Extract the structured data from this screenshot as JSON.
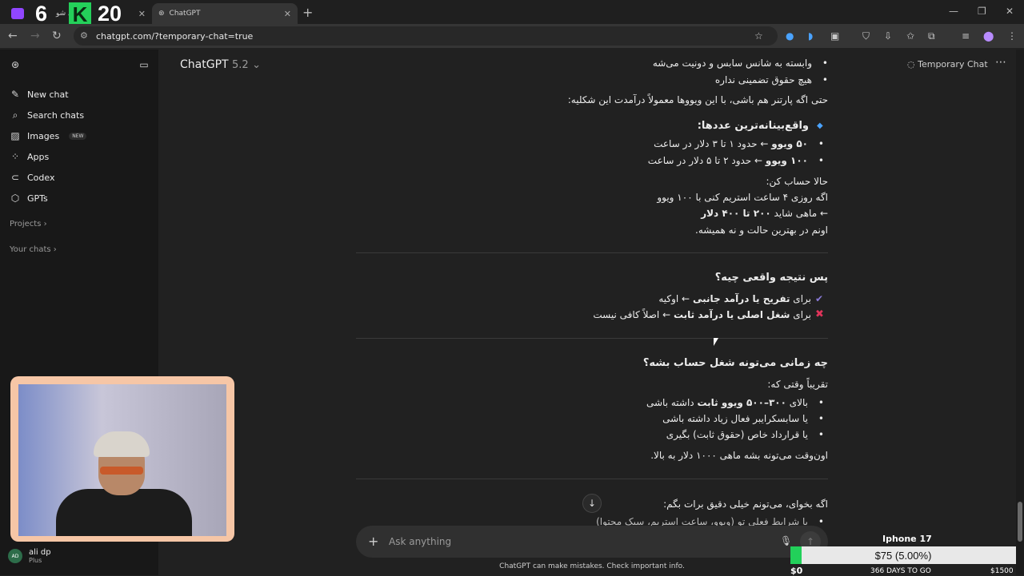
{
  "browser": {
    "tabs": [
      {
        "title": "ل شو",
        "active": false
      },
      {
        "title": "ChatGPT",
        "active": true
      }
    ],
    "url": "chatgpt.com/?temporary-chat=true",
    "overlay_numbers": [
      "6",
      "K",
      "20"
    ]
  },
  "sidebar": {
    "items": [
      {
        "icon": "pencil-square-icon",
        "label": "New chat"
      },
      {
        "icon": "search-icon",
        "label": "Search chats"
      },
      {
        "icon": "image-icon",
        "label": "Images",
        "badge": "NEW"
      },
      {
        "icon": "grid-icon",
        "label": "Apps"
      },
      {
        "icon": "code-icon",
        "label": "Codex"
      },
      {
        "icon": "gpt-icon",
        "label": "GPTs"
      }
    ],
    "sections": [
      "Projects",
      "Your chats"
    ],
    "user": {
      "initials": "AD",
      "name": "ali dp",
      "plan": "Plus"
    }
  },
  "header": {
    "model_name": "ChatGPT",
    "model_version": "5.2",
    "temporary_chat": "Temporary Chat"
  },
  "content": {
    "b_top1": "وابسته به شانس سابس و دونیت می‌شه",
    "b_top2": "هیچ حقوق تضمینی نداره",
    "para1": "حتی اگه پارتنر هم باشی، با این ویووها معمولاً درآمدت این شکلیه:",
    "h_real": "واقع‌بینانه‌ترین عددها:",
    "r1_bold": "۵۰ ویوو",
    "r1_rest": " ← حدود ۱ تا ۳ دلار در ساعت",
    "r2_bold": "۱۰۰ ویوو",
    "r2_rest": " ← حدود ۲ تا ۵ دلار در ساعت",
    "calc1": "حالا حساب کن:",
    "calc2": "اگه روزی ۴ ساعت استریم کنی با ۱۰۰ ویوو",
    "calc3_pre": "← ماهی شاید ",
    "calc3_bold": "۲۰۰ تا ۴۰۰ دلار",
    "calc4": "اونم در بهترین حالت و نه همیشه.",
    "h_result": "پس نتیجه واقعی چیه؟",
    "res1_pre": "برای ",
    "res1_bold": "تفریح یا درآمد جانبی",
    "res1_rest": " ← اوکیه",
    "res2_pre": "برای ",
    "res2_bold": "شغل اصلی یا درآمد ثابت",
    "res2_rest": " ← اصلاً کافی نیست",
    "h_when": "چه زمانی می‌تونه شغل حساب بشه؟",
    "approx": "تقریباً وقتی که:",
    "w1_pre": "بالای ",
    "w1_bold": "۳۰۰–۵۰۰ ویوو ثابت",
    "w1_rest": " داشته باشی",
    "w2": "یا سابسکرایبر فعال زیاد داشته باشی",
    "w3": "یا قرارداد خاص (حقوق ثابت) بگیری",
    "then": "اون‌وقت می‌تونه بشه ماهی ۱۰۰۰ دلار به بالا.",
    "want": "اگه بخوای، می‌تونم خیلی دقیق برات بگم:",
    "last_bullet": "با شرایط فعلی تو (ویوو، ساعت استریم، سبک محتوا)"
  },
  "composer": {
    "placeholder": "Ask anything",
    "disclaimer": "ChatGPT can make mistakes. Check important info."
  },
  "goal": {
    "title": "Iphone 17",
    "amount": "$75 (5.00%)",
    "progress": 0.05,
    "low": "$0",
    "days": "366 DAYS TO GO",
    "high": "$1500"
  },
  "colors": {
    "accent_green": "#22d05a",
    "cross_red": "#e0345a",
    "check_purple": "#8a7ad8"
  }
}
